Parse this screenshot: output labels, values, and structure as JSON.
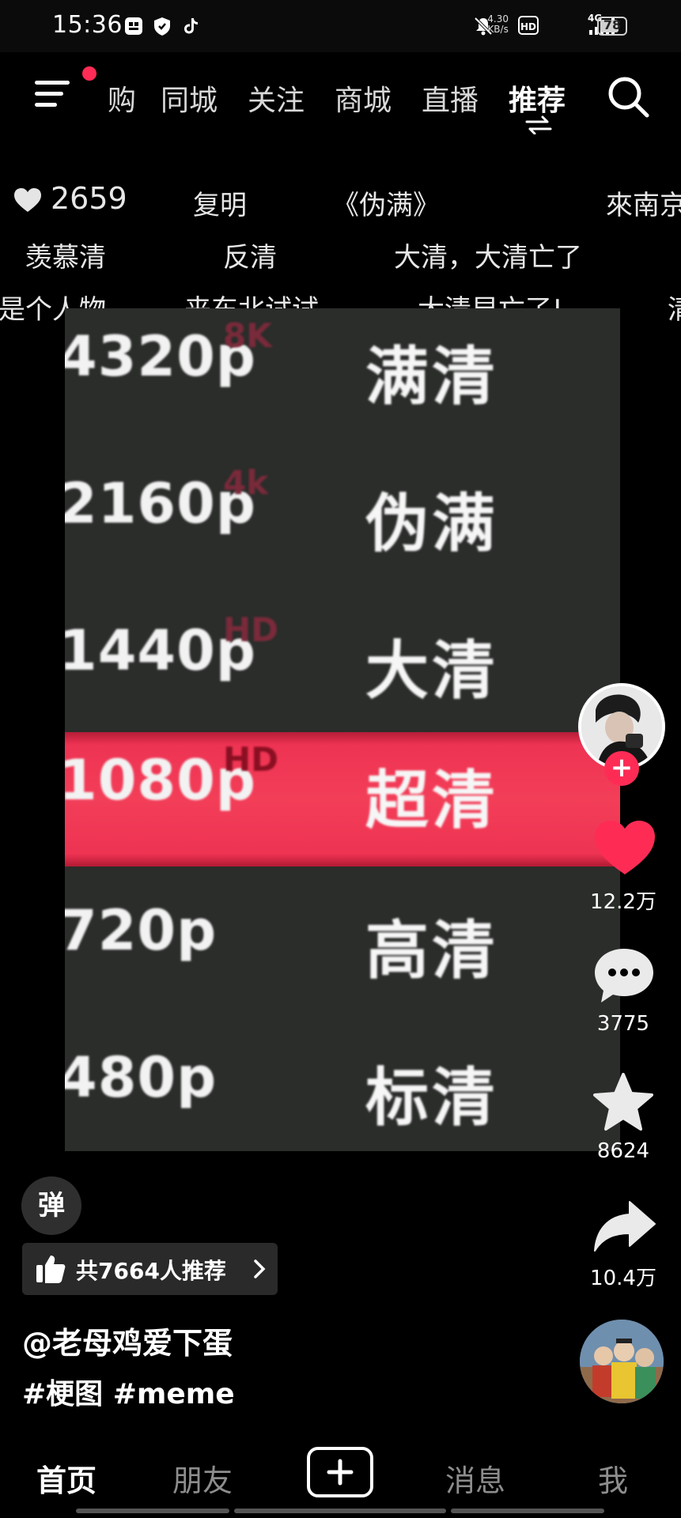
{
  "status_bar": {
    "time": "15:36",
    "net_speed_value": "4.30",
    "net_speed_unit": "KB/s",
    "hd": "HD",
    "signal": "4G",
    "battery": "78",
    "battery_level": 0.78
  },
  "top_nav": {
    "tabs": [
      "购",
      "同城",
      "关注",
      "商城",
      "直播",
      "推荐"
    ],
    "active_tab": "推荐"
  },
  "danmaku": {
    "like_count": "2659",
    "items": [
      "复明",
      "《伪满》",
      "來南京",
      "羡慕清",
      "反清",
      "大清，大清亡了",
      "是个人物",
      "来东北试试",
      "大清早亡了!",
      "清"
    ]
  },
  "content": {
    "rows": [
      {
        "res": "4320p",
        "badge": "8K",
        "label": "满清"
      },
      {
        "res": "2160p",
        "badge": "4k",
        "label": "伪满"
      },
      {
        "res": "1440p",
        "badge": "HD",
        "label": "大清"
      },
      {
        "res": "1080p",
        "badge": "HD",
        "label": "超清"
      },
      {
        "res": "720p",
        "badge": "",
        "label": "高清"
      },
      {
        "res": "480p",
        "badge": "",
        "label": "标清"
      }
    ],
    "highlight_index": 3
  },
  "actions": {
    "likes": "12.2万",
    "comments": "3775",
    "favorites": "8624",
    "shares": "10.4万",
    "follow": "+"
  },
  "meta": {
    "danmaku_toggle": "弹",
    "recommend": "共7664人推荐",
    "author": "@老母鸡爱下蛋",
    "tags": "#梗图 #meme"
  },
  "bottom_nav": {
    "home": "首页",
    "friends": "朋友",
    "messages": "消息",
    "me": "我"
  },
  "colors": {
    "accent": "#fe2c55",
    "highlight": "#f03a56"
  }
}
